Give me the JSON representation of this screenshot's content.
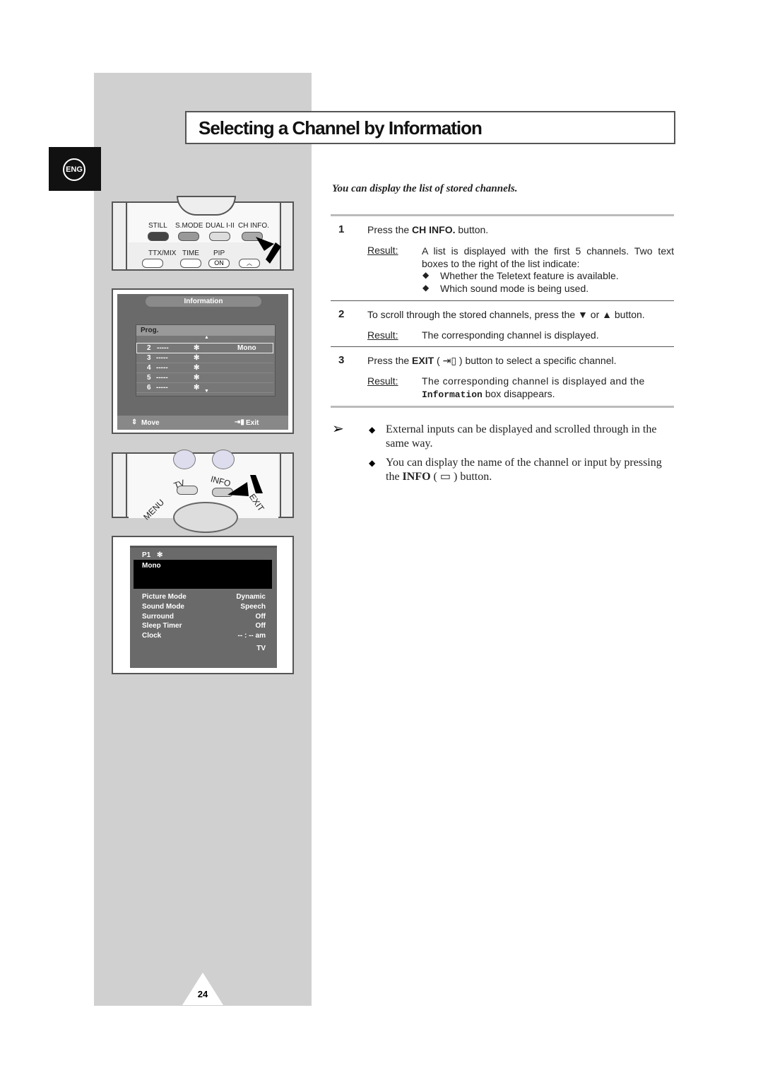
{
  "language_tab": "ENG",
  "title": "Selecting a Channel by Information",
  "intro": "You can display the list of stored channels.",
  "remote1": {
    "labels": [
      "STILL",
      "S.MODE",
      "DUAL I-II",
      "CH INFO."
    ],
    "labels2": [
      "TTX/MIX",
      "TIME",
      "PIP"
    ],
    "pip_button": "ON"
  },
  "osd_list": {
    "header": "Information",
    "column": "Prog.",
    "rows": [
      {
        "num": "2",
        "name": "-----",
        "sound": "Mono"
      },
      {
        "num": "3",
        "name": "-----",
        "sound": ""
      },
      {
        "num": "4",
        "name": "-----",
        "sound": ""
      },
      {
        "num": "5",
        "name": "-----",
        "sound": ""
      },
      {
        "num": "6",
        "name": "-----",
        "sound": ""
      }
    ],
    "move": "Move",
    "exit": "Exit"
  },
  "remote2": {
    "labels": [
      "MENU",
      "TV",
      "INFO",
      "EXIT"
    ]
  },
  "osd_info": {
    "prog": "P1",
    "sound": "Mono",
    "rows": [
      {
        "label": "Picture Mode",
        "value": "Dynamic"
      },
      {
        "label": "Sound Mode",
        "value": "Speech"
      },
      {
        "label": "Surround",
        "value": "Off"
      },
      {
        "label": "Sleep Timer",
        "value": "Off"
      },
      {
        "label": "Clock",
        "value": "-- : -- am"
      }
    ],
    "source": "TV"
  },
  "steps": [
    {
      "num": "1",
      "text_pre": "Press the ",
      "bold": "CH INFO.",
      "text_post": " button.",
      "result_label": "Result:",
      "result": "A list is displayed with the first 5 channels. Two text boxes to the right of the list indicate:",
      "bullets": [
        "Whether the Teletext feature is available.",
        "Which sound mode is being used."
      ]
    },
    {
      "num": "2",
      "text": "To scroll through the stored channels, press the ▼ or ▲ button.",
      "result_label": "Result:",
      "result": "The corresponding channel is displayed."
    },
    {
      "num": "3",
      "text_pre": "Press the ",
      "bold": "EXIT",
      "text_post": " ( ⇥▯ ) button to select a specific channel.",
      "result_label": "Result:",
      "result": "The corresponding channel is displayed and the",
      "mono": "Information",
      "result_post": " box disappears."
    }
  ],
  "notes": [
    "External inputs can be displayed and scrolled through in the same way.",
    "You can display the name  of the channel or input by pressing the "
  ],
  "note2_bold": "INFO",
  "note2_post": " ( ▭ ) button.",
  "page_number": "24"
}
